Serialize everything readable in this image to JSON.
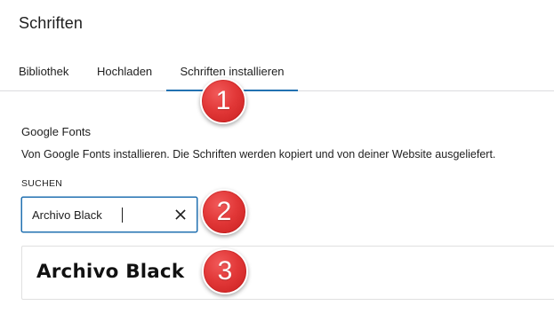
{
  "page": {
    "title": "Schriften"
  },
  "tabs": [
    {
      "label": "Bibliothek",
      "active": false
    },
    {
      "label": "Hochladen",
      "active": false
    },
    {
      "label": "Schriften installieren",
      "active": true
    }
  ],
  "section": {
    "heading": "Google Fonts",
    "description": "Von Google Fonts installieren. Die Schriften werden kopiert und von deiner Website ausgeliefert.",
    "search_label": "SUCHEN",
    "search_value": "Archivo Black",
    "clear_icon": "close-icon"
  },
  "results": [
    {
      "name": "Archivo Black"
    }
  ],
  "annotations": [
    {
      "number": "1"
    },
    {
      "number": "2"
    },
    {
      "number": "3"
    }
  ],
  "colors": {
    "accent": "#2271b1",
    "marker": "#e23838",
    "border": "#dcdcde"
  }
}
